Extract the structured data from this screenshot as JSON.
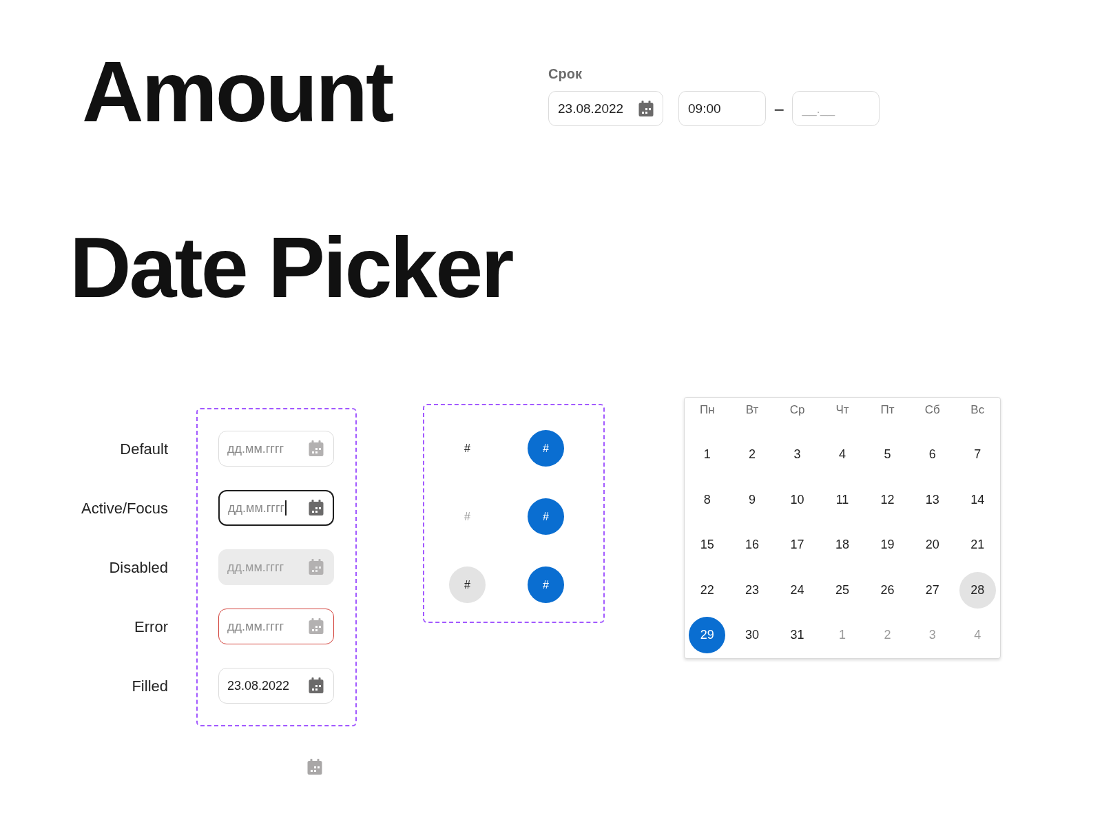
{
  "page_title": "Amount",
  "deadline_form": {
    "label": "Срок",
    "date_field": {
      "value": "23.08.2022"
    },
    "start_time_field": {
      "value": "09:00"
    },
    "separator": "–",
    "end_time_field": {
      "placeholder": "__.__"
    }
  },
  "section_title": "Date Picker",
  "input_states": [
    {
      "label": "Default",
      "kind": "default",
      "placeholder": "дд.мм.гггг"
    },
    {
      "label": "Active/Focus",
      "kind": "focus",
      "placeholder": "дд.мм.гггг"
    },
    {
      "label": "Disabled",
      "kind": "disabled",
      "placeholder": "дд.мм.гггг"
    },
    {
      "label": "Error",
      "kind": "error",
      "placeholder": "дд.мм.гггг"
    },
    {
      "label": "Filled",
      "kind": "filled",
      "value": "23.08.2022"
    }
  ],
  "day_cell_states": [
    {
      "label": "#",
      "muted": false,
      "highlighted": false,
      "selected": false
    },
    {
      "label": "#",
      "muted": false,
      "highlighted": false,
      "selected": true
    },
    {
      "label": "#",
      "muted": true,
      "highlighted": false,
      "selected": false
    },
    {
      "label": "#",
      "muted": false,
      "highlighted": false,
      "selected": true
    },
    {
      "label": "#",
      "muted": false,
      "highlighted": true,
      "selected": false
    },
    {
      "label": "#",
      "muted": false,
      "highlighted": false,
      "selected": true
    }
  ],
  "calendar": {
    "weekdays": [
      "Пн",
      "Вт",
      "Ср",
      "Чт",
      "Пт",
      "Сб",
      "Вс"
    ],
    "days": [
      {
        "label": "1",
        "muted": false,
        "highlighted": false,
        "selected": false
      },
      {
        "label": "2",
        "muted": false,
        "highlighted": false,
        "selected": false
      },
      {
        "label": "3",
        "muted": false,
        "highlighted": false,
        "selected": false
      },
      {
        "label": "4",
        "muted": false,
        "highlighted": false,
        "selected": false
      },
      {
        "label": "5",
        "muted": false,
        "highlighted": false,
        "selected": false
      },
      {
        "label": "6",
        "muted": false,
        "highlighted": false,
        "selected": false
      },
      {
        "label": "7",
        "muted": false,
        "highlighted": false,
        "selected": false
      },
      {
        "label": "8",
        "muted": false,
        "highlighted": false,
        "selected": false
      },
      {
        "label": "9",
        "muted": false,
        "highlighted": false,
        "selected": false
      },
      {
        "label": "10",
        "muted": false,
        "highlighted": false,
        "selected": false
      },
      {
        "label": "11",
        "muted": false,
        "highlighted": false,
        "selected": false
      },
      {
        "label": "12",
        "muted": false,
        "highlighted": false,
        "selected": false
      },
      {
        "label": "13",
        "muted": false,
        "highlighted": false,
        "selected": false
      },
      {
        "label": "14",
        "muted": false,
        "highlighted": false,
        "selected": false
      },
      {
        "label": "15",
        "muted": false,
        "highlighted": false,
        "selected": false
      },
      {
        "label": "16",
        "muted": false,
        "highlighted": false,
        "selected": false
      },
      {
        "label": "17",
        "muted": false,
        "highlighted": false,
        "selected": false
      },
      {
        "label": "18",
        "muted": false,
        "highlighted": false,
        "selected": false
      },
      {
        "label": "19",
        "muted": false,
        "highlighted": false,
        "selected": false
      },
      {
        "label": "20",
        "muted": false,
        "highlighted": false,
        "selected": false
      },
      {
        "label": "21",
        "muted": false,
        "highlighted": false,
        "selected": false
      },
      {
        "label": "22",
        "muted": false,
        "highlighted": false,
        "selected": false
      },
      {
        "label": "23",
        "muted": false,
        "highlighted": false,
        "selected": false
      },
      {
        "label": "24",
        "muted": false,
        "highlighted": false,
        "selected": false
      },
      {
        "label": "25",
        "muted": false,
        "highlighted": false,
        "selected": false
      },
      {
        "label": "26",
        "muted": false,
        "highlighted": false,
        "selected": false
      },
      {
        "label": "27",
        "muted": false,
        "highlighted": false,
        "selected": false
      },
      {
        "label": "28",
        "muted": false,
        "highlighted": true,
        "selected": false
      },
      {
        "label": "29",
        "muted": false,
        "highlighted": false,
        "selected": true
      },
      {
        "label": "30",
        "muted": false,
        "highlighted": false,
        "selected": false
      },
      {
        "label": "31",
        "muted": false,
        "highlighted": false,
        "selected": false
      },
      {
        "label": "1",
        "muted": true,
        "highlighted": false,
        "selected": false
      },
      {
        "label": "2",
        "muted": true,
        "highlighted": false,
        "selected": false
      },
      {
        "label": "3",
        "muted": true,
        "highlighted": false,
        "selected": false
      },
      {
        "label": "4",
        "muted": true,
        "highlighted": false,
        "selected": false
      }
    ]
  }
}
